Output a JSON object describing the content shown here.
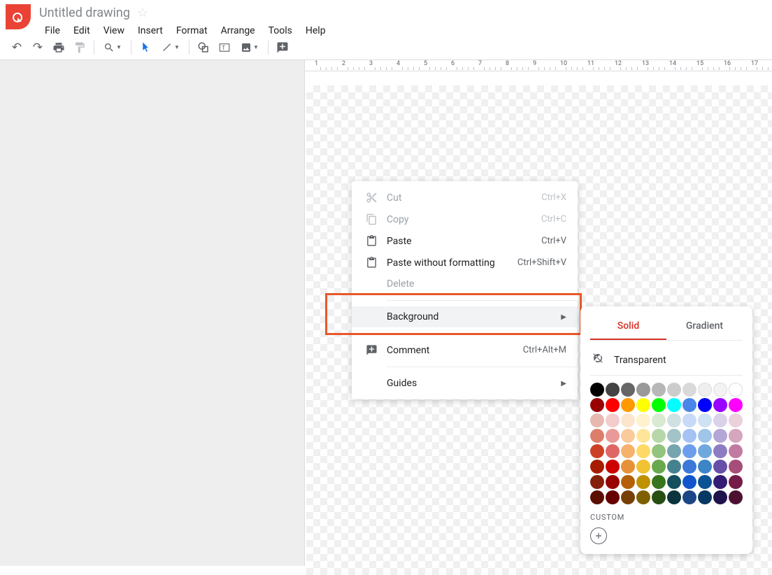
{
  "header": {
    "doc_title": "Untitled drawing",
    "menus": [
      "File",
      "Edit",
      "View",
      "Insert",
      "Format",
      "Arrange",
      "Tools",
      "Help"
    ]
  },
  "ruler": {
    "marks": [
      "1",
      "2",
      "3",
      "4",
      "5",
      "6",
      "7",
      "8",
      "9",
      "10",
      "11",
      "12",
      "13",
      "14",
      "15",
      "16",
      "17"
    ]
  },
  "context_menu": {
    "items": [
      {
        "icon": "cut",
        "label": "Cut",
        "shortcut": "Ctrl+X",
        "disabled": true
      },
      {
        "icon": "copy",
        "label": "Copy",
        "shortcut": "Ctrl+C",
        "disabled": true
      },
      {
        "icon": "paste",
        "label": "Paste",
        "shortcut": "Ctrl+V"
      },
      {
        "icon": "paste",
        "label": "Paste without formatting",
        "shortcut": "Ctrl+Shift+V"
      },
      {
        "label": "Delete",
        "disabled": true
      },
      {
        "divider": true
      },
      {
        "label": "Background",
        "submenu": true,
        "highlighted": true
      },
      {
        "divider": true
      },
      {
        "icon": "comment",
        "label": "Comment",
        "shortcut": "Ctrl+Alt+M"
      },
      {
        "divider": true
      },
      {
        "label": "Guides",
        "submenu": true
      }
    ]
  },
  "color_picker": {
    "tabs": {
      "solid": "Solid",
      "gradient": "Gradient"
    },
    "transparent": "Transparent",
    "custom_label": "CUSTOM",
    "rows": [
      [
        "#000000",
        "#434343",
        "#666666",
        "#999999",
        "#b7b7b7",
        "#cccccc",
        "#d9d9d9",
        "#efefef",
        "#f3f3f3",
        "#ffffff"
      ],
      [
        "#980000",
        "#ff0000",
        "#ff9900",
        "#ffff00",
        "#00ff00",
        "#00ffff",
        "#4a86e8",
        "#0000ff",
        "#9900ff",
        "#ff00ff"
      ],
      [
        "#e6b8af",
        "#f4cccc",
        "#fce5cd",
        "#fff2cc",
        "#d9ead3",
        "#d0e0e3",
        "#c9daf8",
        "#cfe2f3",
        "#d9d2e9",
        "#ead1dc"
      ],
      [
        "#dd7e6b",
        "#ea9999",
        "#f9cb9c",
        "#ffe599",
        "#b6d7a8",
        "#a2c4c9",
        "#a4c2f4",
        "#9fc5e8",
        "#b4a7d6",
        "#d5a6bd"
      ],
      [
        "#cc4125",
        "#e06666",
        "#f6b26b",
        "#ffd966",
        "#93c47d",
        "#76a5af",
        "#6d9eeb",
        "#6fa8dc",
        "#8e7cc3",
        "#c27ba0"
      ],
      [
        "#a61c00",
        "#cc0000",
        "#e69138",
        "#f1c232",
        "#6aa84f",
        "#45818e",
        "#3c78d8",
        "#3d85c6",
        "#674ea7",
        "#a64d79"
      ],
      [
        "#85200c",
        "#990000",
        "#b45f06",
        "#bf9000",
        "#38761d",
        "#134f5c",
        "#1155cc",
        "#0b5394",
        "#351c75",
        "#741b47"
      ],
      [
        "#5b0f00",
        "#660000",
        "#783f04",
        "#7f6000",
        "#274e13",
        "#0c343d",
        "#1c4587",
        "#073763",
        "#20124d",
        "#4c1130"
      ]
    ]
  }
}
